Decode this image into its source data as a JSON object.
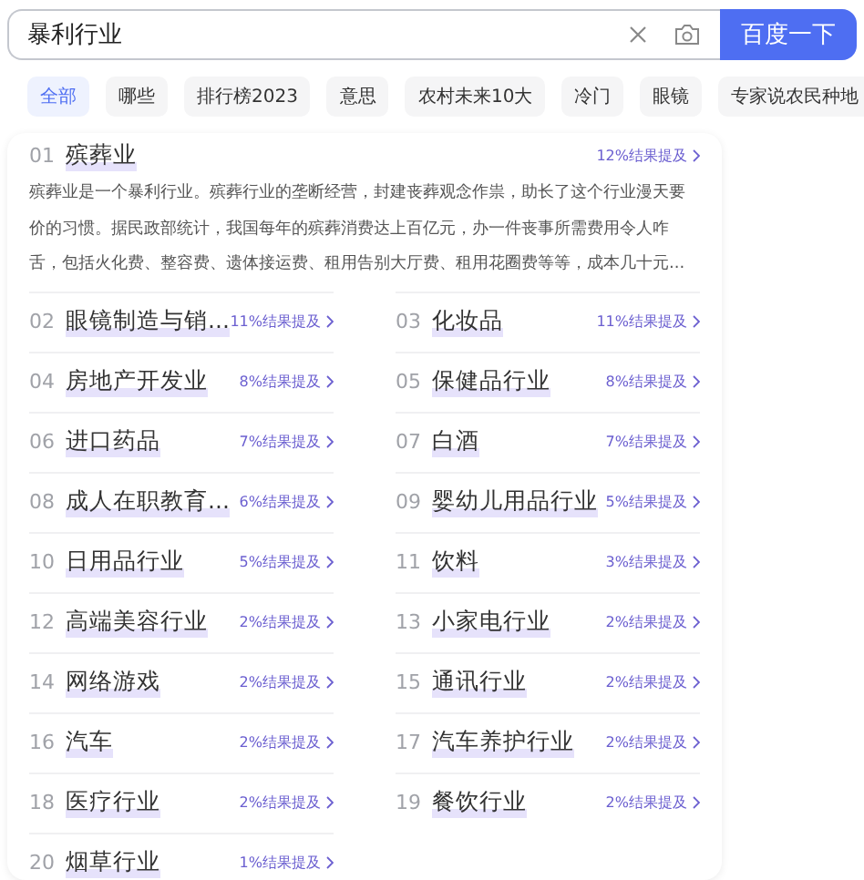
{
  "search": {
    "value": "暴利行业",
    "button": "百度一下"
  },
  "tabs": [
    {
      "label": "全部",
      "selected": true
    },
    {
      "label": "哪些",
      "selected": false
    },
    {
      "label": "排行榜2023",
      "selected": false
    },
    {
      "label": "意思",
      "selected": false
    },
    {
      "label": "农村未来10大",
      "selected": false
    },
    {
      "label": "冷门",
      "selected": false
    },
    {
      "label": "眼镜",
      "selected": false
    },
    {
      "label": "专家说农民种地",
      "selected": false
    }
  ],
  "featured": {
    "rank": "01",
    "name": "殡葬业",
    "mention": "12%结果提及",
    "description": "殡葬业是一个暴利行业。殡葬行业的垄断经营，封建丧葬观念作祟，助长了这个行业漫天要价的习惯。据民政部统计，我国每年的殡葬消费达上百亿元，办一件丧事所需费用令人咋舌，包括火化费、整容费、遗体接运费、租用告别大厅费、租用花圈费等等，成本几十元..."
  },
  "items": [
    {
      "rank": "02",
      "name": "眼镜制造与销...",
      "mention": "11%结果提及"
    },
    {
      "rank": "03",
      "name": "化妆品",
      "mention": "11%结果提及"
    },
    {
      "rank": "04",
      "name": "房地产开发业",
      "mention": "8%结果提及"
    },
    {
      "rank": "05",
      "name": "保健品行业",
      "mention": "8%结果提及"
    },
    {
      "rank": "06",
      "name": "进口药品",
      "mention": "7%结果提及"
    },
    {
      "rank": "07",
      "name": "白酒",
      "mention": "7%结果提及"
    },
    {
      "rank": "08",
      "name": "成人在职教育...",
      "mention": "6%结果提及"
    },
    {
      "rank": "09",
      "name": "婴幼儿用品行业",
      "mention": "5%结果提及"
    },
    {
      "rank": "10",
      "name": "日用品行业",
      "mention": "5%结果提及"
    },
    {
      "rank": "11",
      "name": "饮料",
      "mention": "3%结果提及"
    },
    {
      "rank": "12",
      "name": "高端美容行业",
      "mention": "2%结果提及"
    },
    {
      "rank": "13",
      "name": "小家电行业",
      "mention": "2%结果提及"
    },
    {
      "rank": "14",
      "name": "网络游戏",
      "mention": "2%结果提及"
    },
    {
      "rank": "15",
      "name": "通讯行业",
      "mention": "2%结果提及"
    },
    {
      "rank": "16",
      "name": "汽车",
      "mention": "2%结果提及"
    },
    {
      "rank": "17",
      "name": "汽车养护行业",
      "mention": "2%结果提及"
    },
    {
      "rank": "18",
      "name": "医疗行业",
      "mention": "2%结果提及"
    },
    {
      "rank": "19",
      "name": "餐饮行业",
      "mention": "2%结果提及"
    },
    {
      "rank": "20",
      "name": "烟草行业",
      "mention": "1%结果提及"
    }
  ]
}
